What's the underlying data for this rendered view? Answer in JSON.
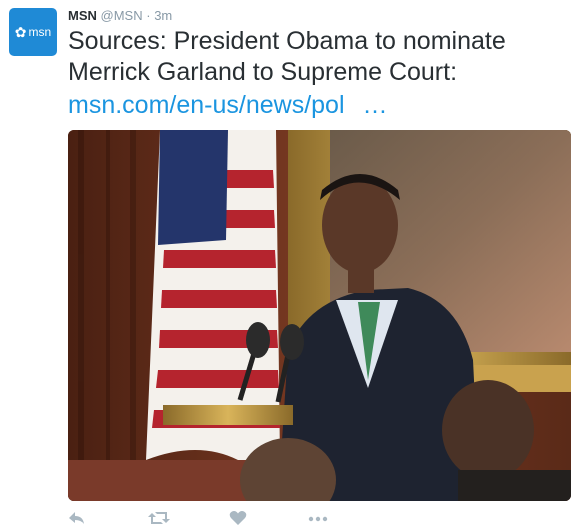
{
  "tweet": {
    "author_name": "MSN",
    "author_handle": "@MSN",
    "separator": "·",
    "time": "3m",
    "avatar_text": "msn",
    "text_line1": "Sources: President Obama to nominate",
    "text_line2": "Merrick Garland to Supreme Court:",
    "link": "msn.com/en-us/news/pol",
    "link_ellipsis": "…"
  },
  "actions": [
    {
      "name": "reply",
      "icon": "reply-icon"
    },
    {
      "name": "retweet",
      "icon": "retweet-icon"
    },
    {
      "name": "like",
      "icon": "heart-icon"
    },
    {
      "name": "more",
      "icon": "more-icon"
    }
  ],
  "colors": {
    "avatar_bg": "#1f8ad6",
    "link": "#1b95e0",
    "muted": "#8899a6",
    "action": "#aab8c2"
  }
}
